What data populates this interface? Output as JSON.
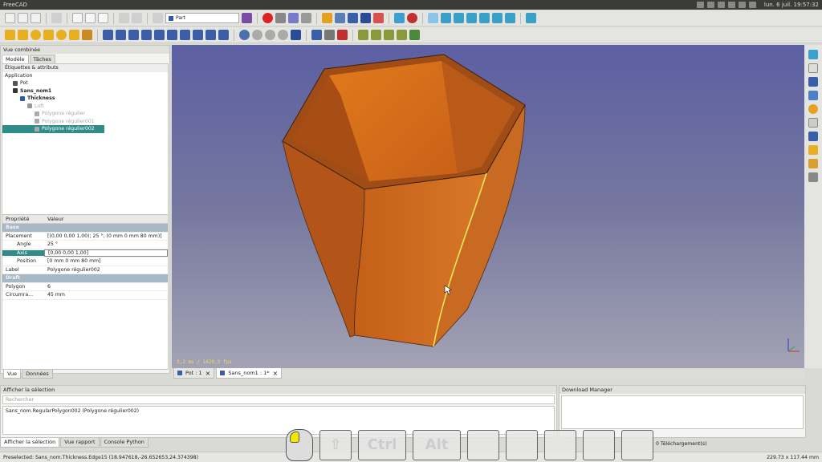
{
  "window": {
    "title": "FreeCAD",
    "clock": "lun. 6 juil. 19:57:32"
  },
  "toolbar": {
    "workbench_selector": "Part"
  },
  "combo_view": {
    "title": "Vue combinée",
    "tabs": [
      "Modèle",
      "Tâches"
    ],
    "tree_header": "Étiquettes & attributs",
    "tree_root": "Application",
    "tree": [
      {
        "label": "Pot",
        "depth": 1,
        "icon_color": "#555"
      },
      {
        "label": "Sans_nom1",
        "depth": 1,
        "icon_color": "#333",
        "bold": true
      },
      {
        "label": "Thickness",
        "depth": 2,
        "icon_color": "#2a5aa8",
        "bold": true
      },
      {
        "label": "Loft",
        "depth": 3,
        "icon_color": "#999",
        "dim": true
      },
      {
        "label": "Polygone régulier",
        "depth": 4,
        "icon_color": "#aaa",
        "dim": true
      },
      {
        "label": "Polygone régulier001",
        "depth": 4,
        "icon_color": "#aaa",
        "dim": true
      },
      {
        "label": "Polygone régulier002",
        "depth": 4,
        "icon_color": "#aaa",
        "selected": true
      }
    ]
  },
  "properties": {
    "headers": [
      "Propriété",
      "Valeur"
    ],
    "groups": [
      {
        "name": "Base",
        "rows": [
          {
            "key": "Placement",
            "value": "[(0,00 0,00 1,00); 25 °; (0 mm  0 mm  80 mm)]",
            "indent": 0
          },
          {
            "key": "Angle",
            "value": "25 °",
            "indent": 1
          },
          {
            "key": "Axis",
            "value": "[0,00 0,00 1,00]",
            "indent": 1,
            "selected": true
          },
          {
            "key": "Position",
            "value": "[0 mm  0 mm  80 mm]",
            "indent": 1
          },
          {
            "key": "Label",
            "value": "Polygone régulier002",
            "indent": 0
          }
        ]
      },
      {
        "name": "Draft",
        "rows": [
          {
            "key": "Polygon",
            "value": "6",
            "indent": 0
          },
          {
            "key": "Circumra...",
            "value": "45 mm",
            "indent": 0
          }
        ]
      }
    ],
    "bottom_tabs": [
      "Vue",
      "Données"
    ]
  },
  "viewport": {
    "fps": "3,2 ms / 1420,3 fps",
    "body_color": "#d06a1e",
    "highlight_color": "#f0e65a"
  },
  "document_tabs": [
    {
      "label": "Pot : 1",
      "active": false
    },
    {
      "label": "Sans_nom1 : 1*",
      "active": true
    }
  ],
  "selection_panel": {
    "title": "Afficher la sélection",
    "search_placeholder": "Rechercher",
    "selected_item": "Sans_nom.RegularPolygon002 (Polygone régulier002)"
  },
  "download_panel": {
    "title": "Download Manager",
    "status": "0 Téléchargement(s)"
  },
  "bottom_tabs": [
    "Afficher la sélection",
    "Vue rapport",
    "Console Python"
  ],
  "status": {
    "message": "Preselected: Sans_nom.Thickness.Edge15 (18.947618,-26.652653,24.374398)",
    "dimensions": "229.73 x 117.44 mm"
  },
  "keys_overlay": {
    "keys": [
      "⇧",
      "Ctrl",
      "Alt",
      "",
      "",
      "",
      "",
      ""
    ]
  }
}
